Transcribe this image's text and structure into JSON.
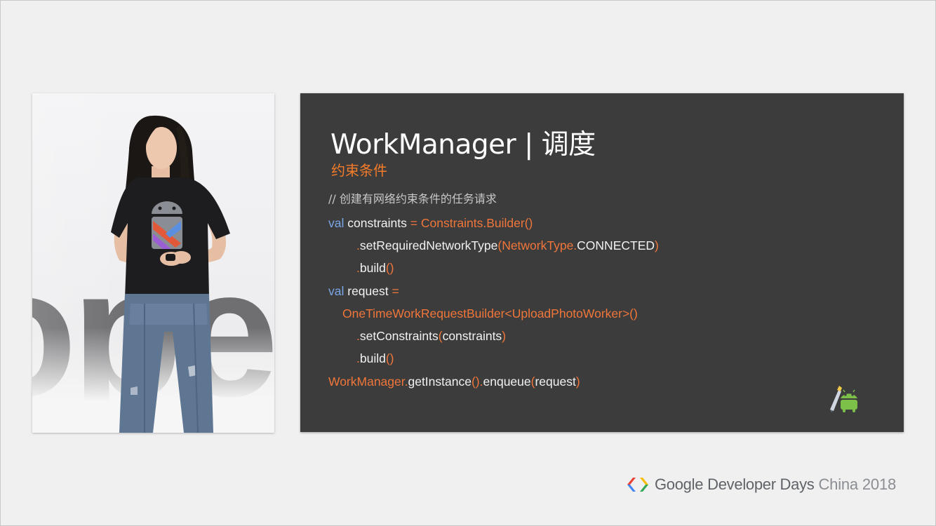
{
  "video": {
    "backdrop_text": "oper"
  },
  "slide": {
    "title": "WorkManager | 调度",
    "subtitle": "约束条件",
    "code": {
      "comment": "// 创建有网络约束条件的任务请求",
      "l1_kw": "val",
      "l1_name": "constraints",
      "l1_eq": "=",
      "l1_class": "Constraints.Builder()",
      "l2_dot": ".",
      "l2_method": "setRequiredNetworkType",
      "l2_open": "(",
      "l2_arg_class": "NetworkType.",
      "l2_arg_value": "CONNECTED",
      "l2_close": ")",
      "l3_dot": ".",
      "l3_method": "build",
      "l3_parens": "()",
      "l4_kw": "val",
      "l4_name": "request",
      "l4_eq": "=",
      "l5_class": "OneTimeWorkRequestBuilder<UploadPhotoWorker>()",
      "l6_dot": ".",
      "l6_method": "setConstraints",
      "l6_open": "(",
      "l6_arg": "constraints",
      "l6_close": ")",
      "l7_dot": ".",
      "l7_method": "build",
      "l7_parens": "()",
      "l8_class": "WorkManager.",
      "l8_method": "getInstance",
      "l8_parens": "().",
      "l8_method2": "enqueue",
      "l8_open": "(",
      "l8_arg": "request",
      "l8_close": ")"
    },
    "mascot_icon": "android-studio-mascot-icon"
  },
  "footer": {
    "logo_icon": "google-developers-chevron-icon",
    "brand_google": "Google",
    "brand_event": "Developer Days",
    "brand_location_year": "China 2018"
  },
  "colors": {
    "slide_bg": "#3c3c3c",
    "accent_orange": "#f0763a",
    "keyword_blue": "#7aa6e6",
    "page_bg": "#f0f0f0"
  }
}
